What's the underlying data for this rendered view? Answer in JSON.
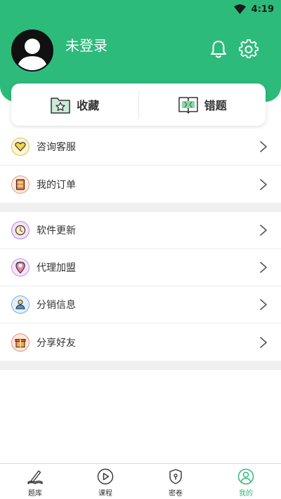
{
  "status_bar": {
    "time": "4:19"
  },
  "profile": {
    "username": "未登录"
  },
  "quick_actions": [
    {
      "label": "收藏",
      "icon": "star-folder-icon"
    },
    {
      "label": "错题",
      "icon": "book-icon"
    }
  ],
  "menu_group_1": [
    {
      "label": "咨询客服",
      "icon": "heart-chat-icon"
    },
    {
      "label": "我的订单",
      "icon": "order-icon"
    }
  ],
  "menu_group_2": [
    {
      "label": "软件更新",
      "icon": "update-icon"
    },
    {
      "label": "代理加盟",
      "icon": "location-icon"
    },
    {
      "label": "分销信息",
      "icon": "distribution-icon"
    },
    {
      "label": "分享好友",
      "icon": "gift-icon"
    }
  ],
  "bottom_nav": [
    {
      "label": "题库",
      "icon": "pen-book-icon"
    },
    {
      "label": "课程",
      "icon": "play-icon"
    },
    {
      "label": "密卷",
      "icon": "lock-shield-icon"
    },
    {
      "label": "我的",
      "icon": "user-icon",
      "active": true
    }
  ],
  "colors": {
    "accent": "#2dbb7b"
  }
}
